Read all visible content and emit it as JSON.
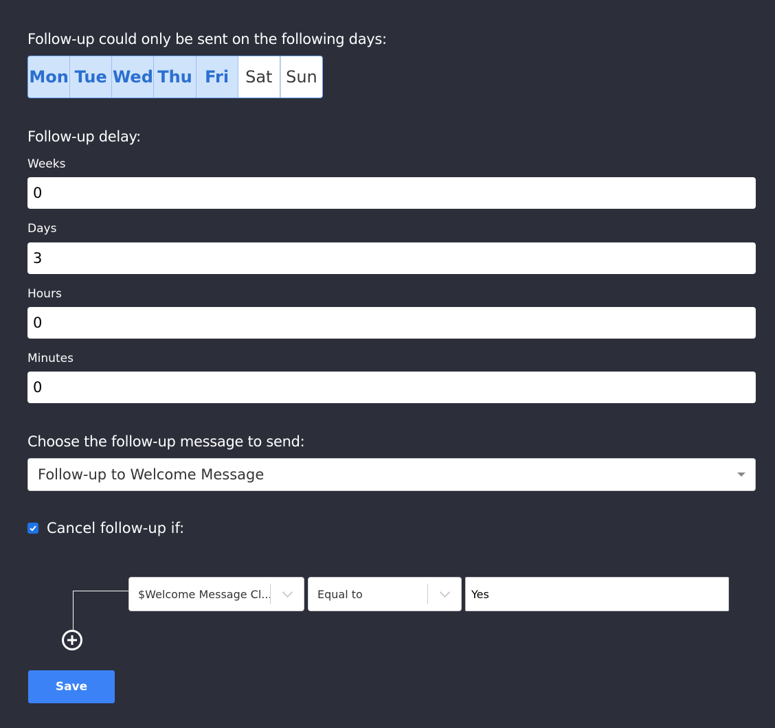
{
  "schedule": {
    "title": "Follow-up could only be sent on the following days:",
    "days": [
      {
        "label": "Mon",
        "selected": true
      },
      {
        "label": "Tue",
        "selected": true
      },
      {
        "label": "Wed",
        "selected": true
      },
      {
        "label": "Thu",
        "selected": true
      },
      {
        "label": "Fri",
        "selected": true
      },
      {
        "label": "Sat",
        "selected": false
      },
      {
        "label": "Sun",
        "selected": false
      }
    ]
  },
  "delay": {
    "title": "Follow-up delay:",
    "weeks": {
      "label": "Weeks",
      "value": "0"
    },
    "days": {
      "label": "Days",
      "value": "3"
    },
    "hours": {
      "label": "Hours",
      "value": "0"
    },
    "minutes": {
      "label": "Minutes",
      "value": "0"
    }
  },
  "message": {
    "title": "Choose the follow-up message to send:",
    "selected": "Follow-up to Welcome Message"
  },
  "cancel": {
    "checked": true,
    "label": "Cancel follow-up if:",
    "condition": {
      "field": "$Welcome Message Cl...",
      "operator": "Equal to",
      "value": "Yes"
    }
  },
  "actions": {
    "save_label": "Save"
  },
  "colors": {
    "background": "#2c2f3a",
    "day_selected_bg": "#cfe3fb",
    "day_selected_text": "#2b6fd0",
    "primary": "#3b82f6"
  }
}
